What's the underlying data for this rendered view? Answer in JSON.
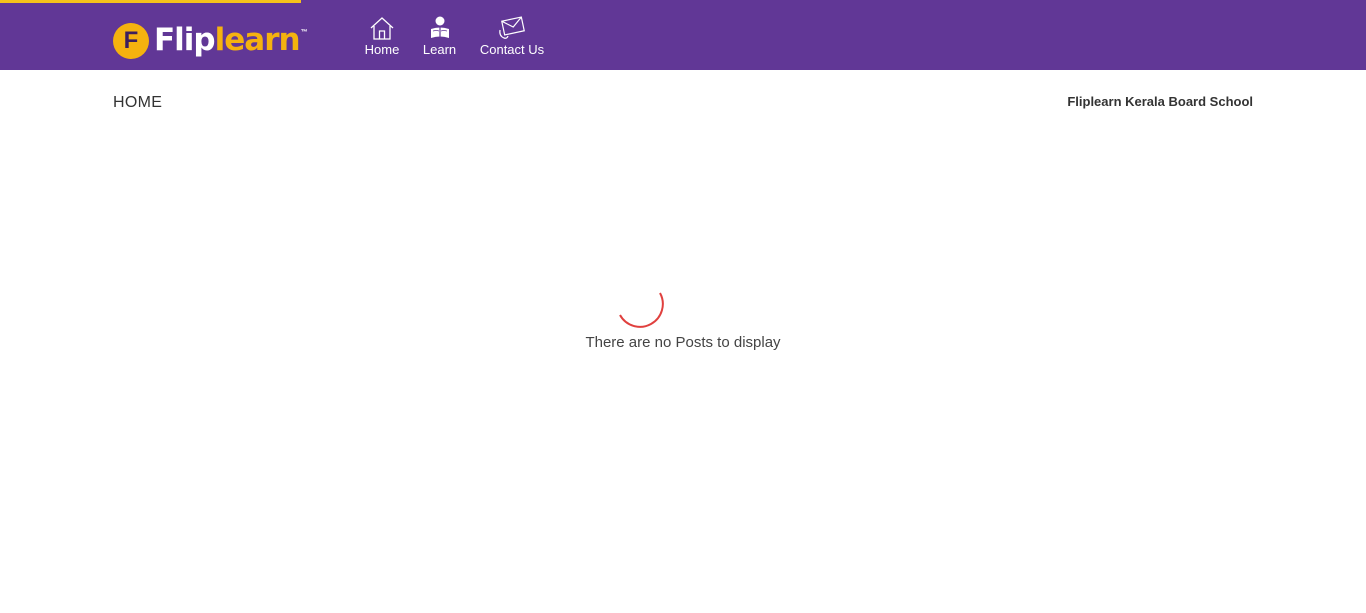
{
  "brand": {
    "name_part1": "Flip",
    "name_part2": "learn",
    "badge_letter": "F",
    "trademark": "™",
    "colors": {
      "header_bg": "#613796",
      "accent": "#f5b20f",
      "progress": "#f5c21b"
    }
  },
  "loading_progress": 0.22,
  "nav": {
    "items": [
      {
        "label": "Home",
        "icon": "home-icon"
      },
      {
        "label": "Learn",
        "icon": "learner-icon"
      },
      {
        "label": "Contact Us",
        "icon": "envelope-icon"
      }
    ]
  },
  "page": {
    "breadcrumb": "HOME",
    "school_name": "Fliplearn Kerala Board School"
  },
  "feed": {
    "spinner": "loading-spinner",
    "spinner_color": "#e0403e",
    "empty_message": "There are no Posts to display"
  }
}
